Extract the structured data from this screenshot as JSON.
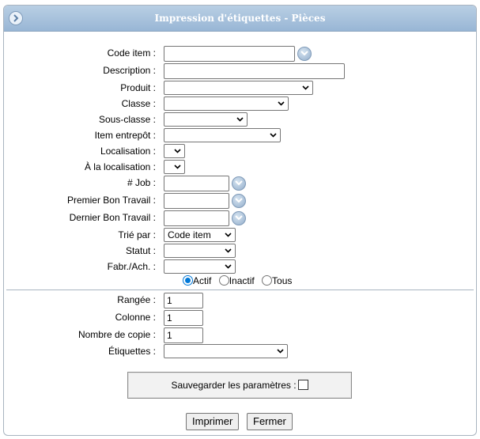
{
  "window": {
    "title": "Impression d'étiquettes - Pièces"
  },
  "form": {
    "code_item_label": "Code item :",
    "description_label": "Description :",
    "produit_label": "Produit :",
    "classe_label": "Classe :",
    "sous_classe_label": "Sous-classe :",
    "item_entrepot_label": "Item entrepôt :",
    "localisation_label": "Localisation :",
    "a_la_localisation_label": "À la localisation :",
    "job_label": "# Job :",
    "premier_bon_label": "Premier Bon Travail :",
    "dernier_bon_label": "Dernier Bon Travail :",
    "trie_par_label": "Trié par :",
    "trie_par_value": "Code item",
    "statut_label": "Statut :",
    "fabr_ach_label": "Fabr./Ach. :",
    "radio_actif": "Actif",
    "radio_inactif": "Inactif",
    "radio_tous": "Tous",
    "radio_selected": "Actif",
    "rangee_label": "Rangée :",
    "rangee_value": "1",
    "colonne_label": "Colonne :",
    "colonne_value": "1",
    "nombre_copie_label": "Nombre de copie :",
    "nombre_copie_value": "1",
    "etiquettes_label": "Étiquettes :",
    "save_params_label": "Sauvegarder les paramètres :",
    "save_params_checked": false
  },
  "buttons": {
    "print": "Imprimer",
    "close": "Fermer"
  },
  "icons": {
    "title": "circle-arrow-right-icon",
    "dropdown": "chevron-down-circle-icon"
  },
  "colors": {
    "title_bar": "#a8c2dd",
    "radio_selected": "#0078d7"
  }
}
